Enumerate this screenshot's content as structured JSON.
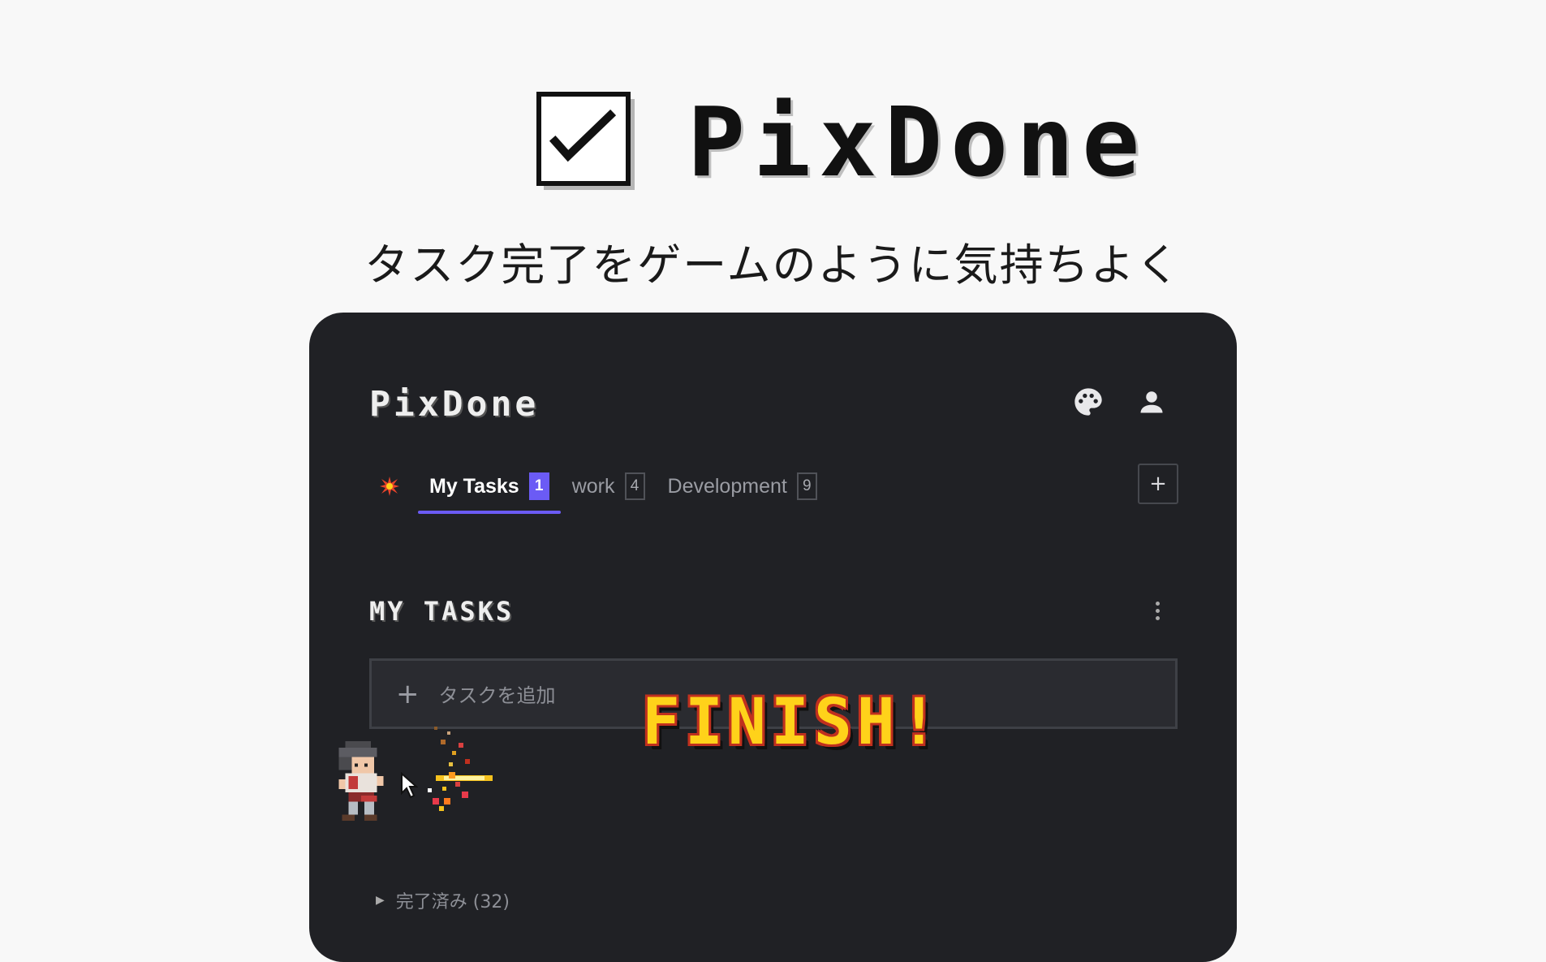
{
  "hero": {
    "logo_icon": "checkbox-check-icon",
    "title": "PixDone",
    "tagline": "タスク完了をゲームのように気持ちよく"
  },
  "app": {
    "title": "PixDone",
    "header_icons": [
      "palette-icon",
      "user-icon"
    ],
    "tabs": [
      {
        "label": "My Tasks",
        "count": "1",
        "active": true
      },
      {
        "label": "work",
        "count": "4",
        "active": false
      },
      {
        "label": "Development",
        "count": "9",
        "active": false
      }
    ],
    "add_tab_label": "+",
    "section_title": "MY TASKS",
    "add_task_placeholder": "タスクを追加",
    "add_task_plus": "+",
    "finish_text": "FINISH!",
    "completed_label": "完了済み (32)",
    "completed_triangle": "▶"
  },
  "colors": {
    "page_bg": "#f8f8f8",
    "app_bg": "#202125",
    "accent": "#6b5bf5",
    "finish_fill": "#ffd21a",
    "finish_outline": "#c0301e"
  }
}
